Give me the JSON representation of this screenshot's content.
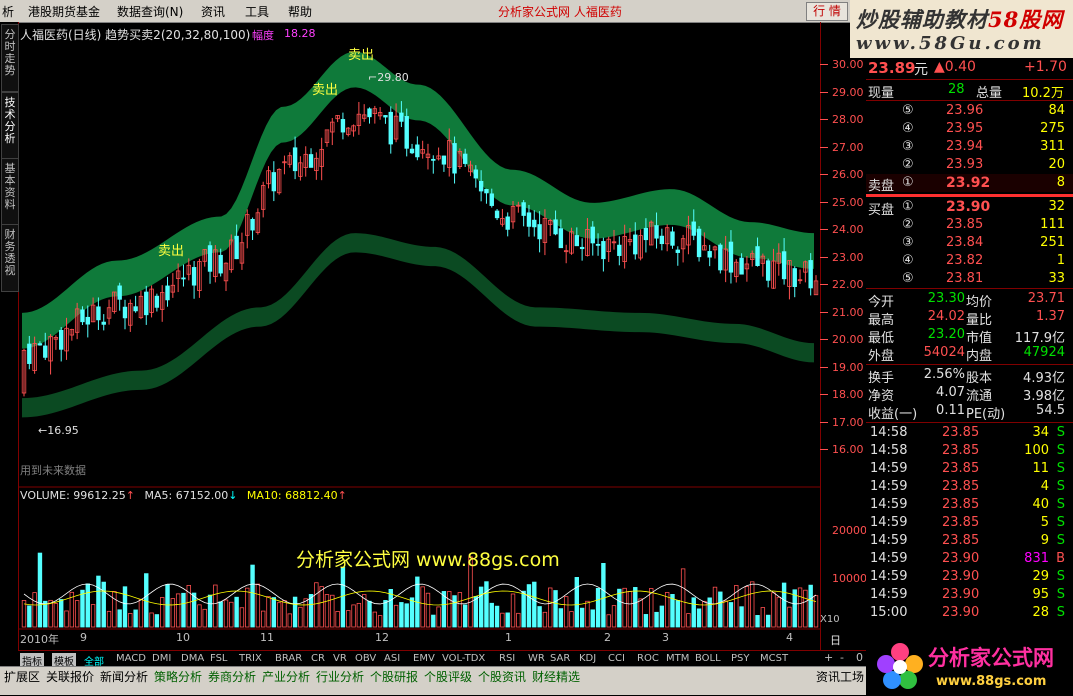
{
  "menubar": {
    "items": [
      "析",
      "港股期货基金",
      "数据查询(N)",
      "资讯",
      "工具",
      "帮助"
    ],
    "title": "分析家公式网 人福医药",
    "quote_button": "行 情"
  },
  "watermark": {
    "line1_a": "炒股辅助教材",
    "line1_b": "58股网",
    "line2": "www.58Gu.com"
  },
  "left_tabs": [
    "分时走势",
    "技术分析",
    "基本资料",
    "财务透视"
  ],
  "chart": {
    "header": "人福医药(日线) 趋势买卖2(20,32,80,100)",
    "amplitude_label": "幅度",
    "amplitude_value": "18.28",
    "sell_label": "卖出",
    "high_marker": "29.80",
    "low_marker": "16.95",
    "future_data_note": "用到未来数据",
    "price_ticks": [
      "30.00",
      "29.00",
      "28.00",
      "27.00",
      "26.00",
      "25.00",
      "24.00",
      "23.00",
      "22.00",
      "21.00",
      "20.00",
      "19.00",
      "18.00",
      "17.00",
      "16.00"
    ],
    "volume_header": {
      "volume": "VOLUME: 99612.25",
      "ma5": "MA5: 67152.00",
      "ma10": "MA10: 68812.40"
    },
    "volume_ticks": [
      "20000",
      "10000"
    ],
    "volume_unit": "X10",
    "watermark_text": "分析家公式网 www.88gs.com",
    "date_labels": [
      "2010年",
      "9",
      "10",
      "11",
      "12",
      "1",
      "2",
      "3",
      "4"
    ],
    "period_button": "日线",
    "indicator_tabs": [
      "指标",
      "模板",
      "全部",
      "MACD",
      "DMI",
      "DMA",
      "FSL",
      "TRIX",
      "BRAR",
      "CR",
      "VR",
      "OBV",
      "ASI",
      "EMV",
      "VOL-TDX",
      "RSI",
      "WR",
      "SAR",
      "KDJ",
      "CCI",
      "ROC",
      "MTM",
      "BOLL",
      "PSY",
      "MCST"
    ]
  },
  "chart_data": {
    "type": "candlestick",
    "title": "人福医药(日线)",
    "ylim": [
      16,
      30
    ],
    "high": 29.8,
    "low": 16.95
  },
  "quote": {
    "price": "23.89",
    "unit": "元",
    "change": "▲0.40",
    "change_pct": "+1.70",
    "current_volume_label": "现量",
    "current_volume": "28",
    "total_volume_label": "总量",
    "total_volume": "10.2万",
    "asks": [
      {
        "level": "⑤",
        "price": "23.96",
        "vol": "84"
      },
      {
        "level": "④",
        "price": "23.95",
        "vol": "275"
      },
      {
        "level": "③",
        "price": "23.94",
        "vol": "311"
      },
      {
        "level": "②",
        "price": "23.93",
        "vol": "20"
      }
    ],
    "ask1": {
      "label": "卖盘",
      "level": "①",
      "price": "23.92",
      "vol": "8"
    },
    "bid1": {
      "label": "买盘",
      "level": "①",
      "price": "23.90",
      "vol": "32"
    },
    "bids": [
      {
        "level": "②",
        "price": "23.85",
        "vol": "111"
      },
      {
        "level": "③",
        "price": "23.84",
        "vol": "251"
      },
      {
        "level": "④",
        "price": "23.82",
        "vol": "1"
      },
      {
        "level": "⑤",
        "price": "23.81",
        "vol": "33"
      }
    ],
    "stats": [
      {
        "l1": "今开",
        "v1": "23.30",
        "c1": "green",
        "l2": "均价",
        "v2": "23.71",
        "c2": "red"
      },
      {
        "l1": "最高",
        "v1": "24.02",
        "c1": "red",
        "l2": "量比",
        "v2": "1.37",
        "c2": "red"
      },
      {
        "l1": "最低",
        "v1": "23.20",
        "c1": "green",
        "l2": "市值",
        "v2": "117.9亿",
        "c2": "white"
      },
      {
        "l1": "外盘",
        "v1": "54024",
        "c1": "red",
        "l2": "内盘",
        "v2": "47924",
        "c2": "green"
      }
    ],
    "stats2": [
      {
        "l1": "换手",
        "v1": "2.56%",
        "l2": "股本",
        "v2": "4.93亿"
      },
      {
        "l1": "净资",
        "v1": "4.07",
        "l2": "流通",
        "v2": "3.98亿"
      },
      {
        "l1": "收益(一)",
        "v1": "0.11",
        "l2": "PE(动)",
        "v2": "54.5"
      }
    ],
    "ticks": [
      {
        "t": "14:58",
        "p": "23.85",
        "v": "34",
        "s": "S"
      },
      {
        "t": "14:58",
        "p": "23.85",
        "v": "100",
        "s": "S"
      },
      {
        "t": "14:59",
        "p": "23.85",
        "v": "11",
        "s": "S"
      },
      {
        "t": "14:59",
        "p": "23.85",
        "v": "4",
        "s": "S"
      },
      {
        "t": "14:59",
        "p": "23.85",
        "v": "40",
        "s": "S"
      },
      {
        "t": "14:59",
        "p": "23.85",
        "v": "5",
        "s": "S"
      },
      {
        "t": "14:59",
        "p": "23.85",
        "v": "9",
        "s": "S"
      },
      {
        "t": "14:59",
        "p": "23.90",
        "v": "831",
        "s": "B"
      },
      {
        "t": "14:59",
        "p": "23.90",
        "v": "29",
        "s": "S"
      },
      {
        "t": "14:59",
        "p": "23.90",
        "v": "95",
        "s": "S"
      },
      {
        "t": "15:00",
        "p": "23.90",
        "v": "28",
        "s": "S"
      }
    ]
  },
  "statusbar": {
    "items": [
      "扩展区",
      "关联报价",
      "新闻分析",
      "策略分析",
      "券商分析",
      "产业分析",
      "行业分析",
      "个股研报",
      "个股评级",
      "个股资讯",
      "财经精选"
    ],
    "right": "资讯工场",
    "scroll": [
      "+",
      "-",
      "0"
    ]
  },
  "logo": {
    "text": "分析家公式网",
    "url": "www.88gs.com"
  },
  "colors": {
    "up": "#ff5050",
    "down": "#54ffff",
    "band_upper": "#0f7a3a",
    "band_lower": "#0b4a22",
    "frame": "#800000"
  }
}
